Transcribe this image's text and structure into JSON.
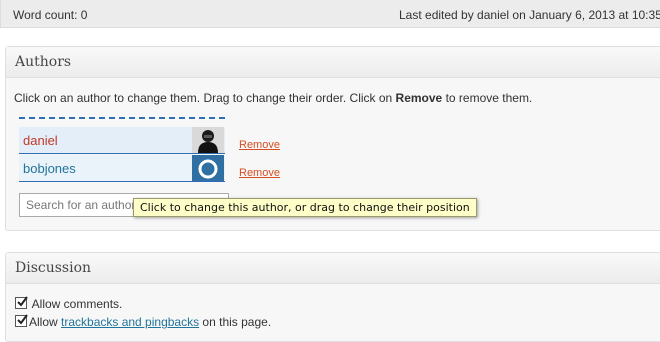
{
  "status": {
    "word_count": "Word count: 0",
    "last_edited": "Last edited by daniel on January 6, 2013 at 10:35"
  },
  "authors_box": {
    "title": "Authors",
    "instructions_pre": "Click on an author to change them. Drag to change their order. Click on ",
    "instructions_bold": "Remove",
    "instructions_post": " to remove them.",
    "authors": [
      {
        "name": "daniel",
        "remove_label": "Remove",
        "avatar": "person-photo-avatar"
      },
      {
        "name": "bobjones",
        "remove_label": "Remove",
        "avatar": "default-blue-avatar"
      }
    ],
    "search_placeholder": "Search for an author",
    "tooltip": "Click to change this author, or drag to change their position"
  },
  "discussion_box": {
    "title": "Discussion",
    "allow_comments": {
      "label": "Allow comments.",
      "checked": true
    },
    "allow_pingbacks": {
      "pre": "Allow ",
      "link": "trackbacks and pingbacks",
      "post": " on this page.",
      "checked": true
    }
  },
  "colors": {
    "accent": "#2f6eb2",
    "remove": "#d54e21",
    "link": "#21759b",
    "tooltip_bg": "#fefec8"
  }
}
